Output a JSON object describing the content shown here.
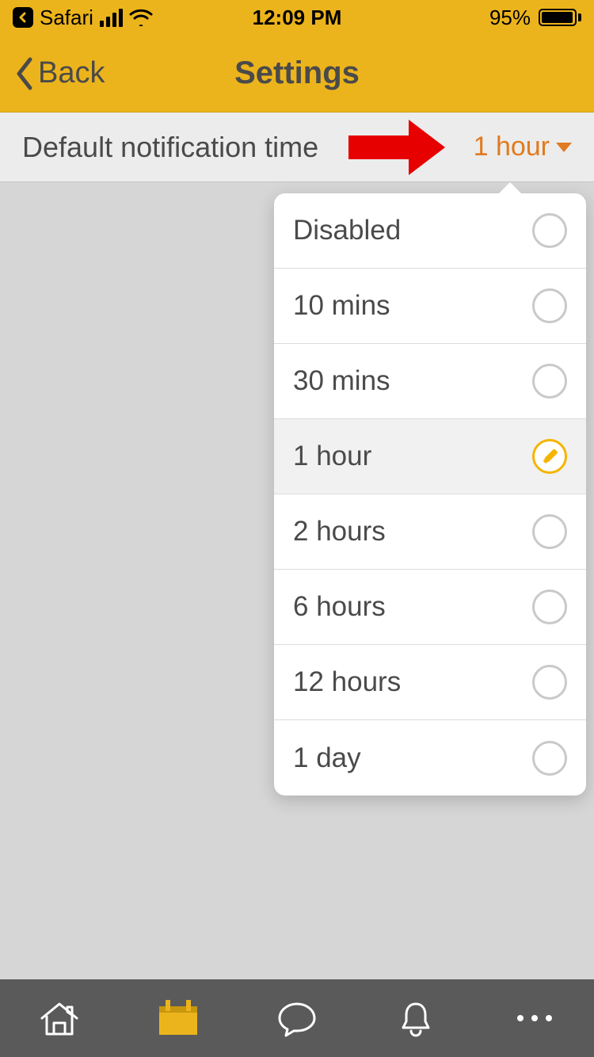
{
  "status_bar": {
    "app_label": "Safari",
    "time": "12:09 PM",
    "battery_percent": "95%"
  },
  "nav": {
    "back_label": "Back",
    "title": "Settings"
  },
  "setting": {
    "label": "Default notification time",
    "value": "1 hour"
  },
  "dropdown": {
    "options": [
      {
        "label": "Disabled",
        "selected": false
      },
      {
        "label": "10 mins",
        "selected": false
      },
      {
        "label": "30 mins",
        "selected": false
      },
      {
        "label": "1 hour",
        "selected": true
      },
      {
        "label": "2 hours",
        "selected": false
      },
      {
        "label": "6 hours",
        "selected": false
      },
      {
        "label": "12 hours",
        "selected": false
      },
      {
        "label": "1 day",
        "selected": false
      }
    ]
  },
  "tabs": {
    "items": [
      {
        "name": "home"
      },
      {
        "name": "calendar"
      },
      {
        "name": "chat"
      },
      {
        "name": "notifications"
      },
      {
        "name": "more"
      }
    ],
    "active_index": 1
  },
  "colors": {
    "brand_yellow": "#ecb41c",
    "accent_orange": "#e07b1f",
    "annotation_red": "#e60000"
  }
}
